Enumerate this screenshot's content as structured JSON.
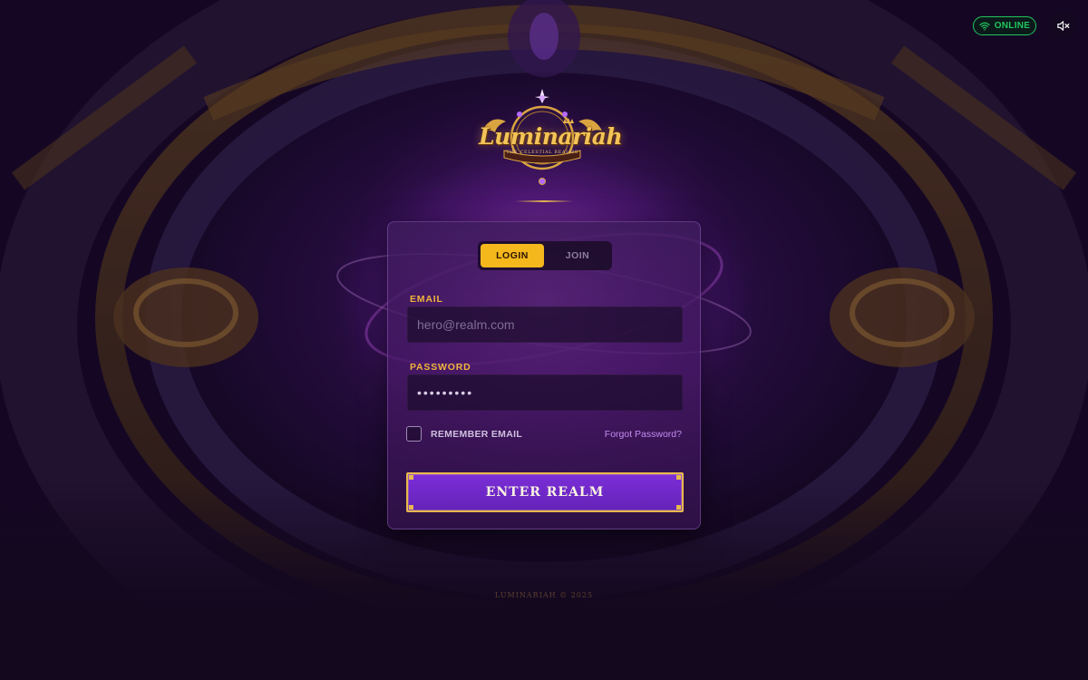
{
  "status": {
    "label": "ONLINE",
    "color": "#22c55e",
    "icon": "wifi-icon"
  },
  "sound": {
    "icon": "speaker-muted-icon"
  },
  "logo": {
    "title": "Luminariah",
    "subtitle": "THE CELESTIAL REALMS"
  },
  "auth": {
    "tabs": [
      {
        "label": "LOGIN",
        "active": true
      },
      {
        "label": "JOIN",
        "active": false
      }
    ],
    "email": {
      "label": "EMAIL",
      "placeholder": "hero@realm.com",
      "value": ""
    },
    "password": {
      "label": "PASSWORD",
      "value": "•••••••••"
    },
    "remember": {
      "label": "REMEMBER EMAIL",
      "checked": false
    },
    "forgot_label": "Forgot Password?",
    "submit_label": "ENTER REALM"
  },
  "footer": {
    "text": "LUMINARIAH © 2025"
  },
  "colors": {
    "accent": "#f5b81c",
    "primary": "#6f28c8",
    "gold": "#e9b84d",
    "background": "#14081f"
  }
}
